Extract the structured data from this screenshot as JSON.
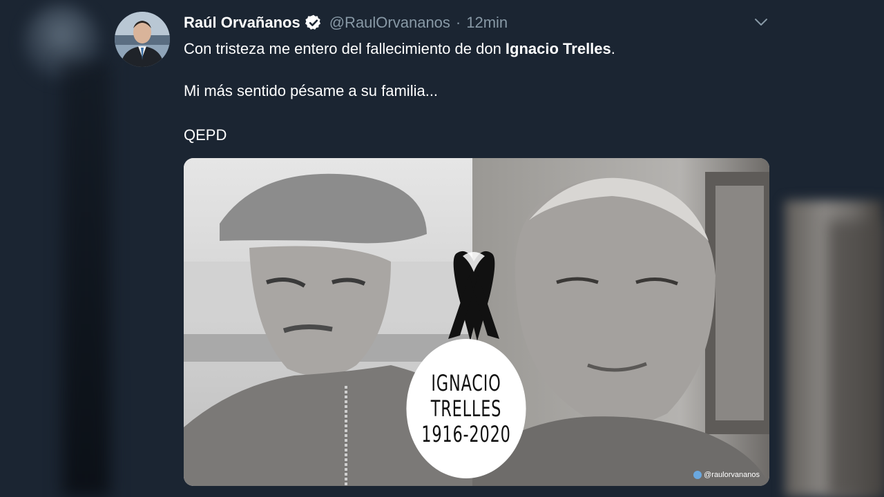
{
  "tweet": {
    "display_name": "Raúl Orvañanos",
    "handle": "@RaulOrvananos",
    "separator": "·",
    "time": "12min",
    "verified": true,
    "line1_prefix": "Con tristeza me entero del fallecimiento de don ",
    "line1_bold": "Ignacio Trelles",
    "line1_suffix": ".",
    "line2": "Mi más sentido pésame a su familia...",
    "line3": "QEPD"
  },
  "media": {
    "circle_name_1": "IGNACIO",
    "circle_name_2": "TRELLES",
    "circle_years": "1916-2020",
    "watermark": "@raulorvananos"
  },
  "colors": {
    "background": "#1b2532",
    "secondary_text": "#8899a6",
    "verified_badge": "#ffffff"
  },
  "icons": [
    "verified-badge-icon",
    "chevron-down-icon",
    "mourning-ribbon-icon",
    "twitter-bird-icon"
  ]
}
